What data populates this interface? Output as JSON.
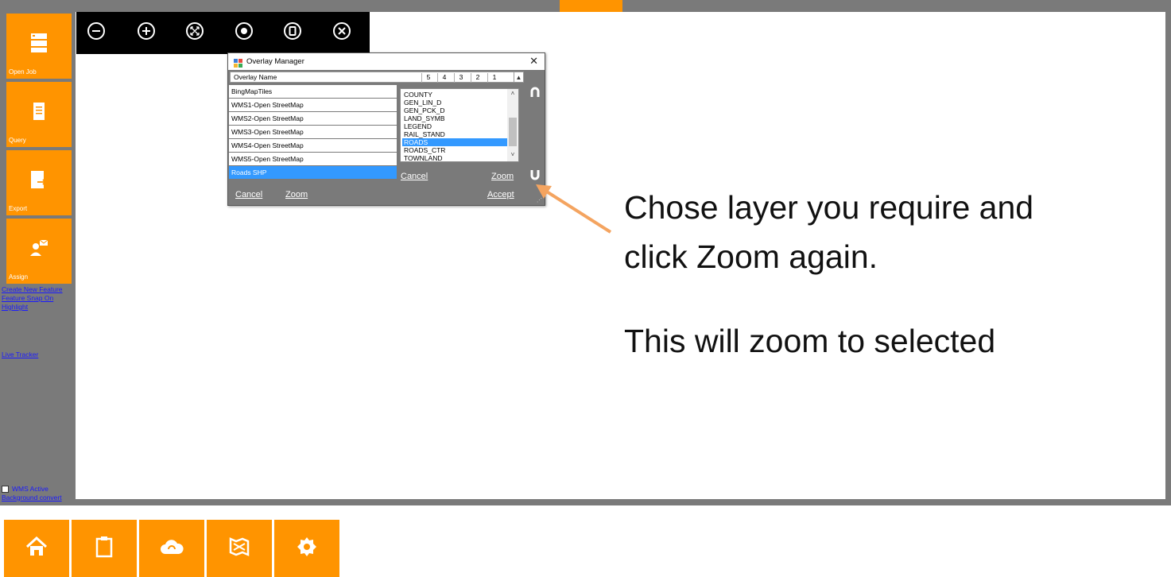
{
  "sidebar": {
    "tiles": [
      {
        "label": "Open Job",
        "icon": "server-icon"
      },
      {
        "label": "Query",
        "icon": "document-icon"
      },
      {
        "label": "Export",
        "icon": "export-icon"
      },
      {
        "label": "Assign",
        "icon": "assign-user-icon"
      }
    ],
    "links": [
      "Create New Feature",
      "Feature Snap On",
      "Highlight",
      "Live Tracker"
    ],
    "wms_active_label": "WMS Active",
    "background_convert_label": "Background convert"
  },
  "map_toolbar": {
    "buttons": [
      "zoom-out-icon",
      "zoom-in-icon",
      "zoom-extent-icon",
      "center-icon",
      "pause-icon",
      "close-circle-icon"
    ]
  },
  "overlay_manager": {
    "title": "Overlay Manager",
    "column_name": "Overlay Name",
    "columns": [
      "5",
      "4",
      "3",
      "2",
      "1"
    ],
    "overlays": [
      "BingMapTiles",
      "WMS1-Open StreetMap",
      "WMS2-Open StreetMap",
      "WMS3-Open StreetMap",
      "WMS4-Open StreetMap",
      "WMS5-Open StreetMap",
      "Roads SHP"
    ],
    "selected_overlay": "Roads SHP",
    "layers": [
      "COUNTY",
      "GEN_LIN_D",
      "GEN_PCK_D",
      "LAND_SYMB",
      "LEGEND",
      "RAIL_STAND",
      "ROADS",
      "ROADS_CTR",
      "TOWNLAND"
    ],
    "selected_layer": "ROADS",
    "layer_cancel": "Cancel",
    "layer_zoom": "Zoom",
    "cancel": "Cancel",
    "zoom": "Zoom",
    "accept": "Accept"
  },
  "annotation": {
    "line1": "Chose layer you require and",
    "line2": "click Zoom again.",
    "line3": "This will zoom to selected",
    "arrow_color": "#f4a460"
  },
  "bottom_bar": {
    "tiles": [
      {
        "icon": "home-icon"
      },
      {
        "icon": "clipboard-icon"
      },
      {
        "icon": "cloud-sync-icon"
      },
      {
        "icon": "map-icon"
      },
      {
        "icon": "settings-gear-icon"
      }
    ]
  },
  "colors": {
    "accent": "#ff9400",
    "frame": "#7a7a7a",
    "selection": "#3399ff"
  }
}
